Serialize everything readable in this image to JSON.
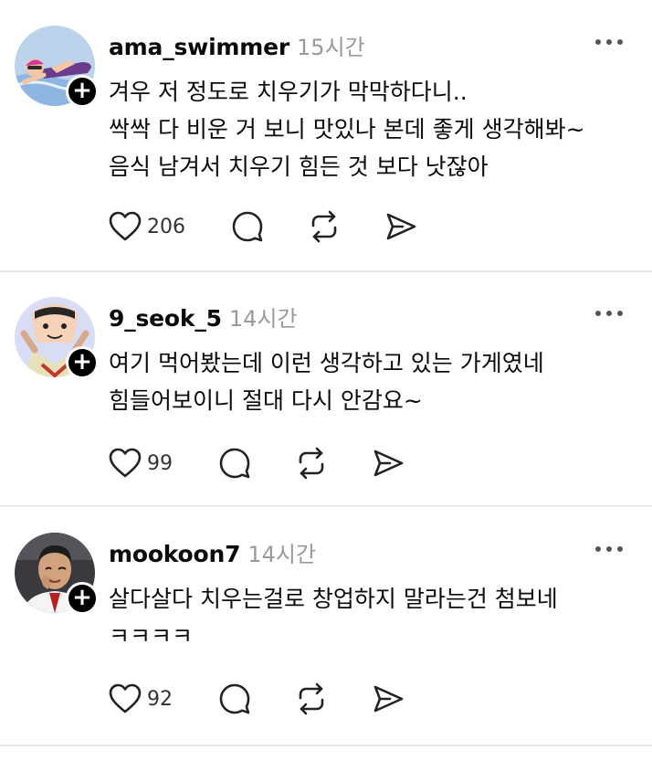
{
  "posts": [
    {
      "username": "ama_swimmer",
      "time": "15시간",
      "lines": [
        "겨우 저 정도로 치우기가 막막하다니..",
        "싹싹 다 비운 거 보니 맛있나 본데 좋게 생각해봐~",
        "음식 남겨서 치우기 힘든 것 보다 낫잖아"
      ],
      "likes": "206",
      "follow_symbol": "+"
    },
    {
      "username": "9_seok_5",
      "time": "14시간",
      "lines": [
        "여기 먹어봤는데 이런 생각하고 있는 가게였네",
        "힘들어보이니 절대 다시 안감요~"
      ],
      "likes": "99",
      "follow_symbol": "+"
    },
    {
      "username": "mookoon7",
      "time": "14시간",
      "lines": [
        "살다살다 치우는걸로 창업하지 말라는건 첨보네",
        "ㅋㅋㅋㅋ"
      ],
      "likes": "92",
      "follow_symbol": "+"
    }
  ],
  "icons": {
    "like": "heart-icon",
    "comment": "comment-icon",
    "repost": "repost-icon",
    "share": "share-icon",
    "more": "more-icon"
  },
  "colors": {
    "text": "#0a0a0a",
    "muted": "#9a9a9a",
    "divider": "#e8e8e8",
    "badge": "#000000"
  }
}
